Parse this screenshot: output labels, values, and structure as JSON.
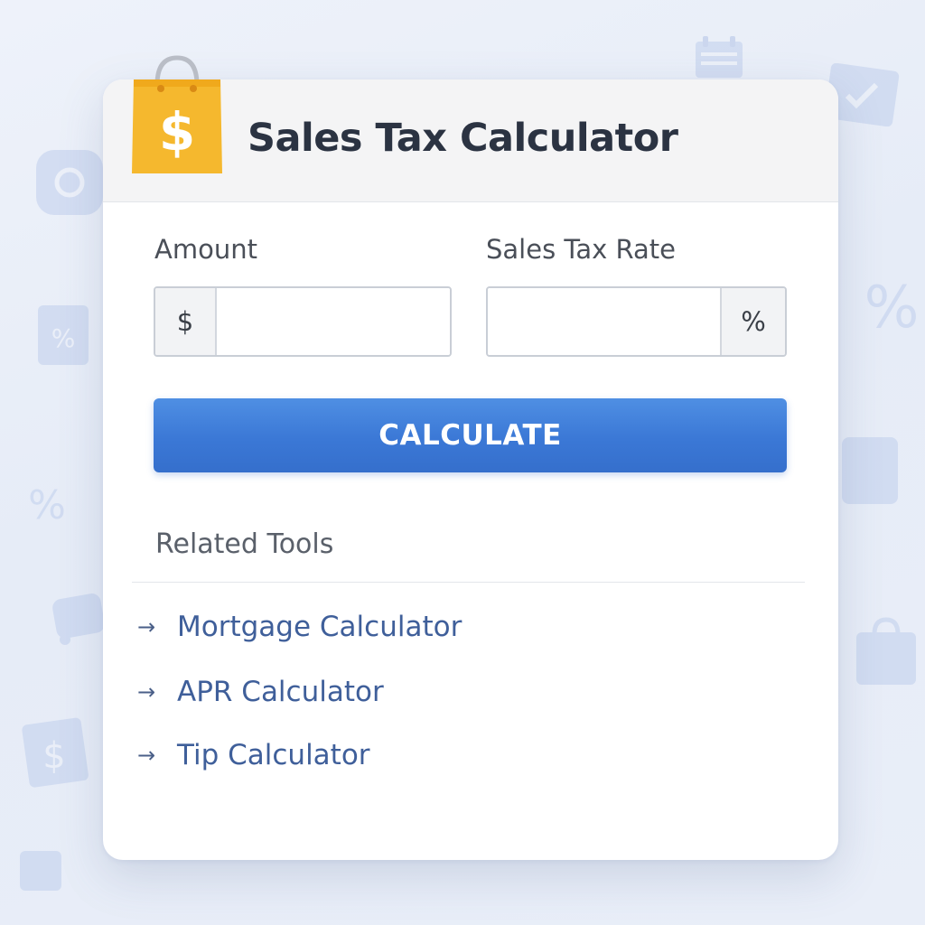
{
  "app": {
    "title": "Sales Tax Calculator",
    "icon": "shopping-bag-dollar-icon",
    "icon_glyph": "$"
  },
  "form": {
    "amount": {
      "label": "Amount",
      "prefix": "$",
      "value": "",
      "placeholder": ""
    },
    "tax_rate": {
      "label": "Sales Tax Rate",
      "suffix": "%",
      "value": "",
      "placeholder": ""
    },
    "calculate_label": "CALCULATE"
  },
  "related": {
    "title": "Related Tools",
    "arrow_glyph": "→",
    "items": [
      {
        "label": "Mortgage Calculator"
      },
      {
        "label": "APR Calculator"
      },
      {
        "label": "Tip Calculator"
      }
    ]
  },
  "colors": {
    "accent": "#3b78d6",
    "bag": "#f5b82e",
    "link": "#3f5f9a",
    "title": "#2b3342"
  }
}
